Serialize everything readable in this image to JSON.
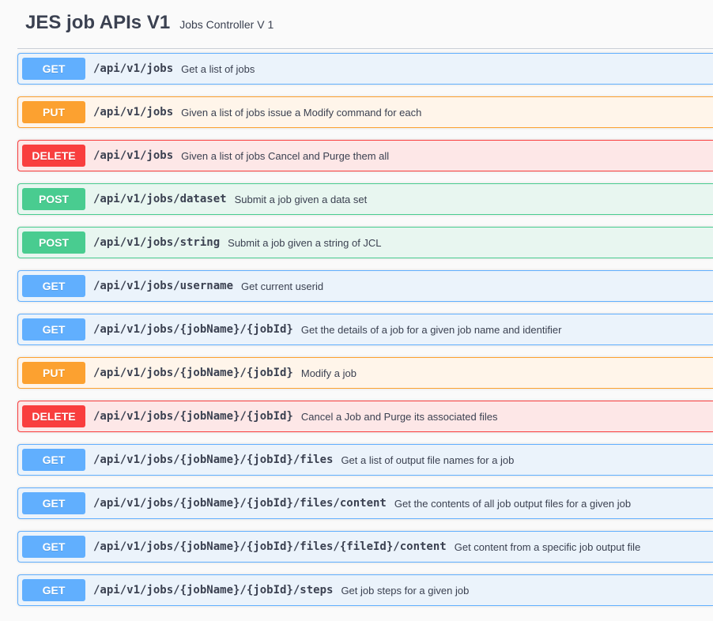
{
  "tag": {
    "title": "JES job APIs V1",
    "description": "Jobs Controller V 1"
  },
  "colors": {
    "get": "#61affe",
    "put": "#fca130",
    "delete": "#f93e3e",
    "post": "#49cc90",
    "text": "#3b4151"
  },
  "operations": [
    {
      "method": "GET",
      "path": "/api/v1/jobs",
      "summary": "Get a list of jobs"
    },
    {
      "method": "PUT",
      "path": "/api/v1/jobs",
      "summary": "Given a list of jobs issue a Modify command for each"
    },
    {
      "method": "DELETE",
      "path": "/api/v1/jobs",
      "summary": "Given a list of jobs Cancel and Purge them all"
    },
    {
      "method": "POST",
      "path": "/api/v1/jobs/dataset",
      "summary": "Submit a job given a data set"
    },
    {
      "method": "POST",
      "path": "/api/v1/jobs/string",
      "summary": "Submit a job given a string of JCL"
    },
    {
      "method": "GET",
      "path": "/api/v1/jobs/username",
      "summary": "Get current userid"
    },
    {
      "method": "GET",
      "path": "/api/v1/jobs/{jobName}/{jobId}",
      "summary": "Get the details of a job for a given job name and identifier"
    },
    {
      "method": "PUT",
      "path": "/api/v1/jobs/{jobName}/{jobId}",
      "summary": "Modify a job"
    },
    {
      "method": "DELETE",
      "path": "/api/v1/jobs/{jobName}/{jobId}",
      "summary": "Cancel a Job and Purge its associated files"
    },
    {
      "method": "GET",
      "path": "/api/v1/jobs/{jobName}/{jobId}/files",
      "summary": "Get a list of output file names for a job"
    },
    {
      "method": "GET",
      "path": "/api/v1/jobs/{jobName}/{jobId}/files/content",
      "summary": "Get the contents of all job output files for a given job"
    },
    {
      "method": "GET",
      "path": "/api/v1/jobs/{jobName}/{jobId}/files/{fileId}/content",
      "summary": "Get content from a specific job output file"
    },
    {
      "method": "GET",
      "path": "/api/v1/jobs/{jobName}/{jobId}/steps",
      "summary": "Get job steps for a given job"
    }
  ]
}
